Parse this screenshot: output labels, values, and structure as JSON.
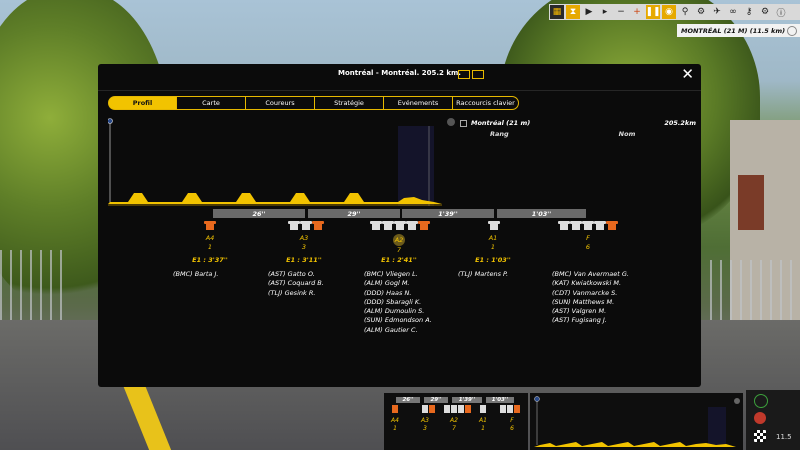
{
  "stage_banner": "MONTRÉAL (21 M) (11.5 km)",
  "panel": {
    "title": "Montréal - Montréal. 205.2 km.",
    "tabs": [
      "Profil",
      "Carte",
      "Coureurs",
      "Stratégie",
      "Evénements",
      "Raccourcis clavier"
    ],
    "current_place": "Montréal (21 m)",
    "distance": "205.2km",
    "col_rank": "Rang",
    "col_name": "Nom"
  },
  "gaps": [
    "26''",
    "29''",
    "1'39''",
    "1'03''"
  ],
  "groups": [
    {
      "label": "A4",
      "count": "1",
      "time": "E1 : 3'37''",
      "riders": [
        "(BMC) Barta J."
      ]
    },
    {
      "label": "A3",
      "count": "3",
      "time": "E1 : 3'11''",
      "riders": [
        "(AST) Gatto O.",
        "(AST) Coquard B.",
        "(TLJ) Gesink R."
      ]
    },
    {
      "label": "A2",
      "count": "7",
      "time": "E1 : 2'41''",
      "riders": [
        "(BMC) Vliegen L.",
        "(ALM) Gogl M.",
        "(DDD) Haas N.",
        "(DDD) Sbaragli K.",
        "(ALM) Dumoulin S.",
        "(SUN) Edmondson A.",
        "(ALM) Gautier C."
      ]
    },
    {
      "label": "A1",
      "count": "1",
      "time": "E1 : 1'03''",
      "riders": [
        "(TLJ) Martens P."
      ]
    },
    {
      "label": "F",
      "count": "6",
      "time": "",
      "riders": [
        "(BMC) Van Avermaet G.",
        "(KAT) Kwiatkowski M.",
        "(CDT) Vanmarcke S.",
        "(SUN) Matthews M.",
        "(AST) Valgren M.",
        "(AST) Fugisang J."
      ]
    }
  ],
  "mini": {
    "gaps": [
      "26''",
      "29''",
      "1'39''",
      "1'03''"
    ],
    "groups": [
      {
        "label": "A4",
        "count": "1"
      },
      {
        "label": "A3",
        "count": "3"
      },
      {
        "label": "A2",
        "count": "7"
      },
      {
        "label": "A1",
        "count": "1"
      },
      {
        "label": "F",
        "count": "6"
      }
    ],
    "speed": "11.5"
  },
  "colors": {
    "accent": "#f2c300",
    "panel": "#0b0b0b",
    "leader_jersey": "#e8691e"
  },
  "icons": [
    "hourglass-icon",
    "play-icon",
    "minus-icon",
    "plus-icon",
    "pause-icon",
    "eye-icon",
    "settings-icon",
    "info-icon",
    "close-icon"
  ]
}
